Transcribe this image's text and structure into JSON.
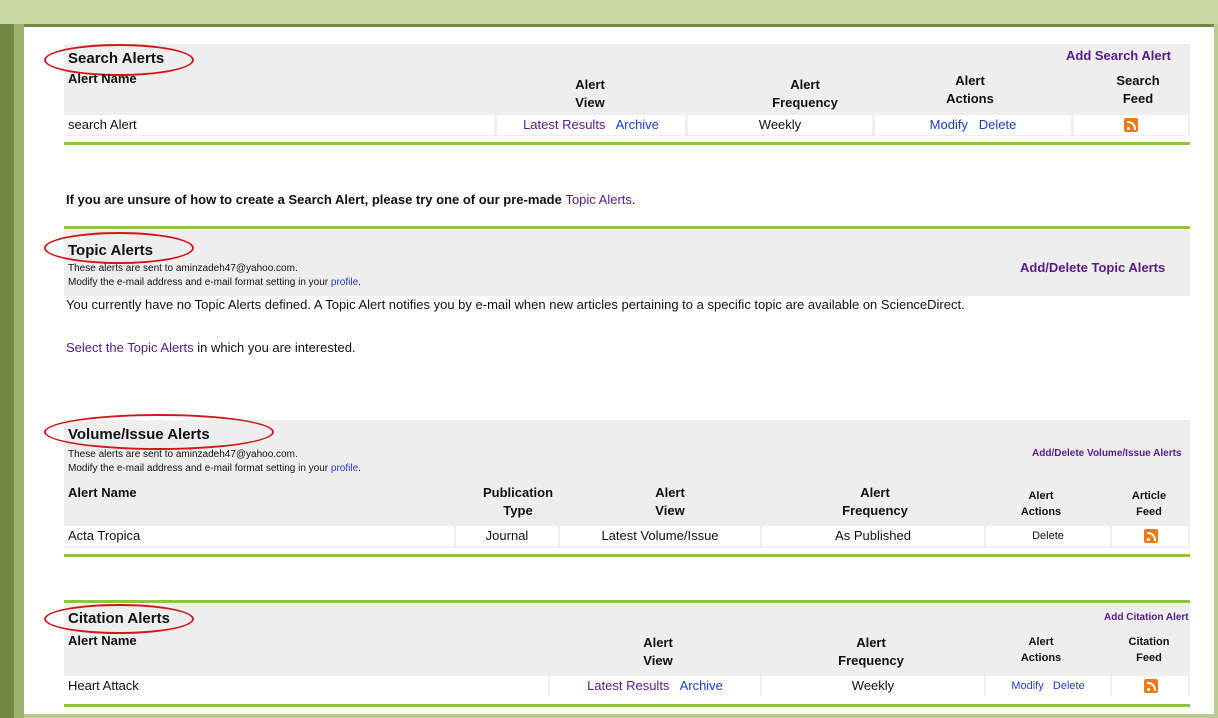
{
  "search": {
    "title": "Search Alerts",
    "add_link": "Add Search Alert",
    "headers": {
      "name": "Alert Name",
      "view": "Alert View",
      "frequency": "Alert Frequency",
      "actions": "Alert Actions",
      "feed": "Search Feed"
    },
    "row": {
      "name": "search Alert",
      "latest": "Latest Results",
      "archive": "Archive",
      "frequency": "Weekly",
      "modify": "Modify",
      "delete": "Delete"
    }
  },
  "hint": {
    "prefix": "If you are unsure of how to create a Search Alert, please try one of our pre-made ",
    "link": "Topic Alerts",
    "suffix": "."
  },
  "topic": {
    "title": "Topic Alerts",
    "sent_line": "These alerts are sent to aminzadeh47@yahoo.com.",
    "modify_prefix": "Modify the e-mail address and e-mail format setting in your ",
    "profile": "profile",
    "add_link": "Add/Delete Topic Alerts",
    "none_text": "You currently have no Topic Alerts defined. A Topic Alert notifies you by e-mail when new articles pertaining to a specific topic are available on ScienceDirect.",
    "select_link": "Select the Topic Alerts",
    "select_suffix": " in which you are interested."
  },
  "volume": {
    "title": "Volume/Issue Alerts",
    "sent_line": "These alerts are sent to aminzadeh47@yahoo.com.",
    "modify_prefix": "Modify the e-mail address and e-mail format setting in your ",
    "profile": "profile",
    "add_link": "Add/Delete Volume/Issue Alerts",
    "headers": {
      "name": "Alert Name",
      "pubtype": "Publication Type",
      "view": "Alert View",
      "frequency": "Alert Frequency",
      "actions": "Alert Actions",
      "feed": "Article Feed"
    },
    "row": {
      "name": "Acta Tropica",
      "pubtype": "Journal",
      "view": "Latest Volume/Issue",
      "frequency": "As Published",
      "delete": "Delete"
    }
  },
  "citation": {
    "title": "Citation Alerts",
    "add_link": "Add Citation Alert",
    "headers": {
      "name": "Alert Name",
      "view": "Alert View",
      "frequency": "Alert Frequency",
      "actions": "Alert Actions",
      "feed": "Citation Feed"
    },
    "row": {
      "name": "Heart Attack",
      "latest": "Latest Results",
      "archive": "Archive",
      "frequency": "Weekly",
      "modify": "Modify",
      "delete": "Delete"
    }
  },
  "colors": {
    "highlight": "#d01818",
    "rule": "#8cc63f",
    "link": "#5a1a8a",
    "action": "#1a3fcc",
    "rss": "#f07a12"
  }
}
